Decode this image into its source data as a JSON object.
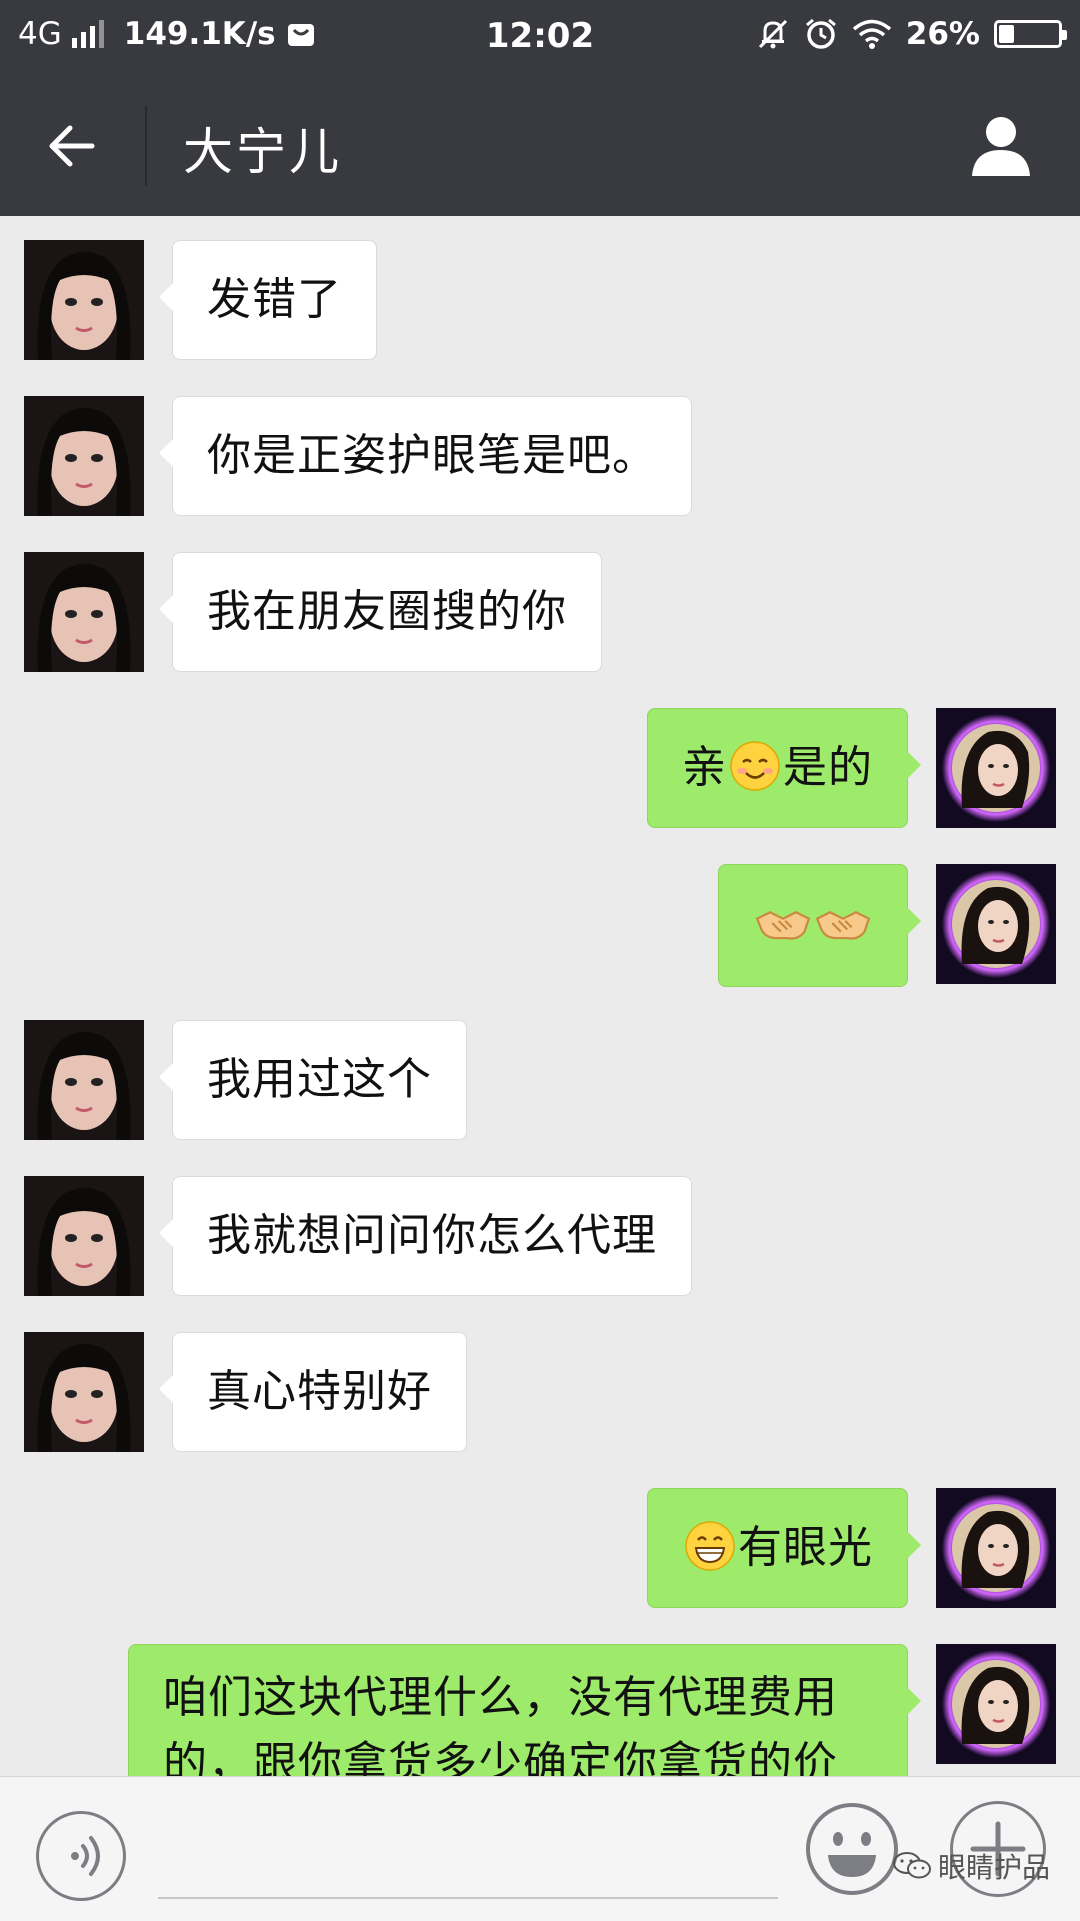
{
  "status_bar": {
    "network": "4G",
    "speed": "149.1K/s",
    "time": "12:02",
    "battery": "26%",
    "battery_level": 0.26
  },
  "nav": {
    "title": "大宁儿"
  },
  "messages": [
    {
      "side": "in",
      "text": "发错了"
    },
    {
      "side": "in",
      "text": "你是正姿护眼笔是吧。"
    },
    {
      "side": "in",
      "text": "我在朋友圈搜的你"
    },
    {
      "side": "out",
      "text_before": "亲",
      "emoji": "smiling-blush-emoji",
      "text_after": "是的"
    },
    {
      "side": "out",
      "emoji_pair": [
        "handshake-emoji",
        "handshake-emoji"
      ]
    },
    {
      "side": "in",
      "text": "我用过这个"
    },
    {
      "side": "in",
      "text": "我就想问问你怎么代理"
    },
    {
      "side": "in",
      "text": "真心特别好"
    },
    {
      "side": "out",
      "emoji": "grinning-emoji",
      "text_after": "有眼光"
    },
    {
      "side": "out",
      "text": "咱们这块代理什么，没有代理费用的，跟你拿货多少确定你拿货的价"
    }
  ],
  "bottom_bar": {
    "input_value": ""
  },
  "watermark": {
    "text": "眼睛护品",
    "icon": "wechat-icon"
  },
  "colors": {
    "header_bg": "#393a3f",
    "chat_bg": "#ebebeb",
    "outgoing_bubble": "#9eea6a",
    "incoming_bubble": "#ffffff"
  }
}
